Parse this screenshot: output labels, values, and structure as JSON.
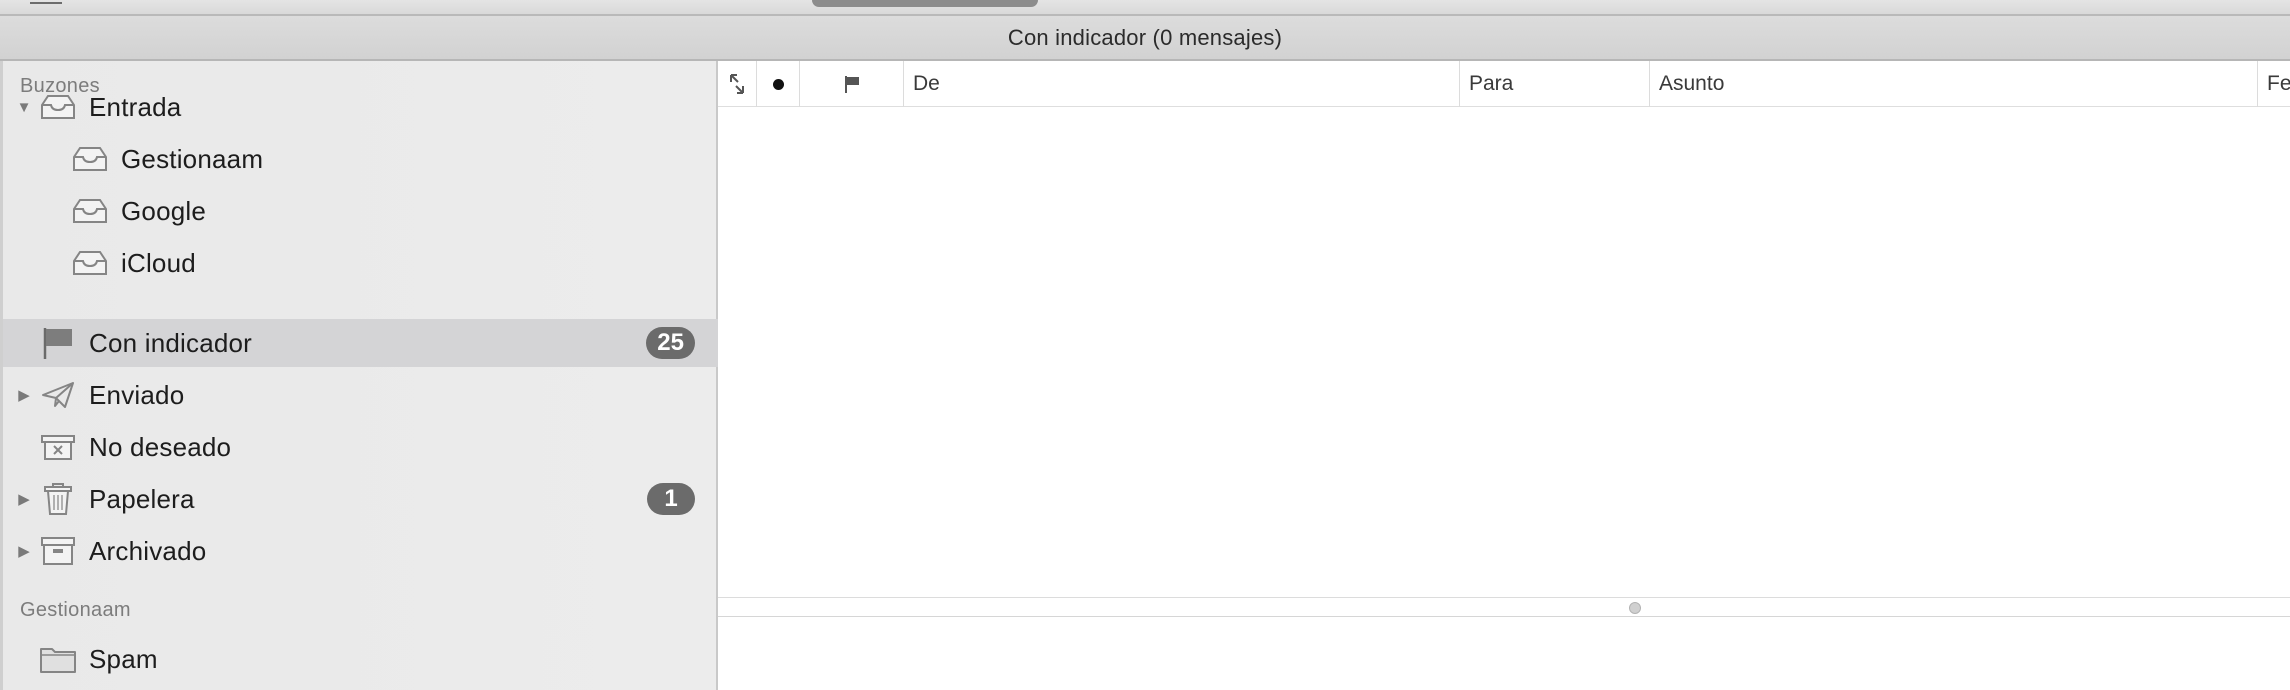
{
  "window": {
    "title": "Con indicador (0 mensajes)"
  },
  "sidebar": {
    "sections": [
      {
        "heading": "Buzones",
        "items": [
          {
            "label": "Entrada",
            "icon": "inbox-tray-icon",
            "disclosure": "expanded",
            "badge": ""
          },
          {
            "label": "Gestionaam",
            "icon": "inbox-tray-icon",
            "disclosure": "",
            "badge": ""
          },
          {
            "label": "Google",
            "icon": "inbox-tray-icon",
            "disclosure": "",
            "badge": ""
          },
          {
            "label": "iCloud",
            "icon": "inbox-tray-icon",
            "disclosure": "",
            "badge": ""
          },
          {
            "label": "Con indicador",
            "icon": "flag-icon",
            "disclosure": "",
            "badge": "25",
            "selected": true
          },
          {
            "label": "Enviado",
            "icon": "paper-plane-icon",
            "disclosure": "collapsed",
            "badge": ""
          },
          {
            "label": "No deseado",
            "icon": "junk-box-icon",
            "disclosure": "",
            "badge": ""
          },
          {
            "label": "Papelera",
            "icon": "trash-icon",
            "disclosure": "collapsed",
            "badge": "1"
          },
          {
            "label": "Archivado",
            "icon": "archive-box-icon",
            "disclosure": "collapsed",
            "badge": ""
          }
        ]
      },
      {
        "heading": "Gestionaam",
        "items": [
          {
            "label": "Spam",
            "icon": "folder-icon",
            "disclosure": "",
            "badge": ""
          }
        ]
      }
    ]
  },
  "message_list": {
    "columns": [
      {
        "label": "",
        "icon": "thread-expand-icon"
      },
      {
        "label": "",
        "icon": "unread-dot-icon"
      },
      {
        "label": "",
        "icon": "flag-column-icon"
      },
      {
        "label": "De"
      },
      {
        "label": "Para"
      },
      {
        "label": "Asunto"
      },
      {
        "label": "Fe"
      }
    ],
    "rows": []
  },
  "colors": {
    "sidebar_bg": "#ebebeb",
    "selection_bg": "#d4d4d6",
    "badge_bg": "#6b6b6b",
    "icon_gray": "#8a8a8a"
  }
}
